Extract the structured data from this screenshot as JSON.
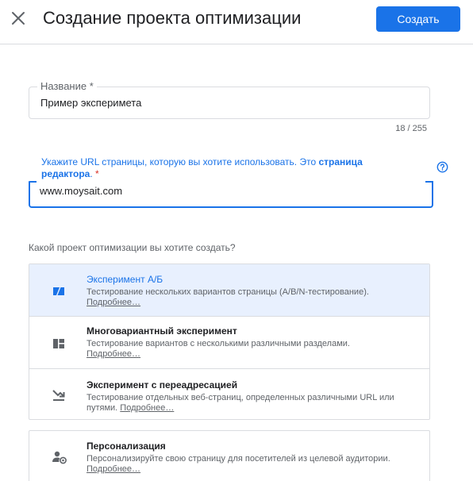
{
  "header": {
    "title": "Создание проекта оптимизации",
    "create_label": "Создать"
  },
  "name_field": {
    "label": "Название *",
    "value": "Пример эксперимета",
    "counter": "18 / 255"
  },
  "url_field": {
    "label_text": "Укажите URL страницы, которую вы хотите использовать. Это ",
    "label_bold": "страница редактора",
    "label_tail": ". ",
    "label_star": "*",
    "value": "www.moysait.com"
  },
  "question": "Какой проект оптимизации вы хотите создать?",
  "options": [
    {
      "title": "Эксперимент А/Б",
      "desc": "Тестирование нескольких вариантов страницы (A/B/N-тестирование).",
      "more": "Подробнее…"
    },
    {
      "title": "Многовариантный эксперимент",
      "desc": "Тестирование вариантов с несколькими различными разделами.",
      "more": "Подробнее…"
    },
    {
      "title": "Эксперимент с переадресацией",
      "desc": "Тестирование отдельных веб-страниц, определенных различными URL или путями.",
      "more": "Подробнее…"
    }
  ],
  "personalization": {
    "title": "Персонализация",
    "desc": "Персонализируйте свою страницу для посетителей из целевой аудитории.",
    "more": "Подробнее…"
  },
  "colors": {
    "primary": "#1a73e8",
    "selected_bg": "#e8f0fe",
    "border": "#dadce0",
    "required": "#d93025"
  }
}
